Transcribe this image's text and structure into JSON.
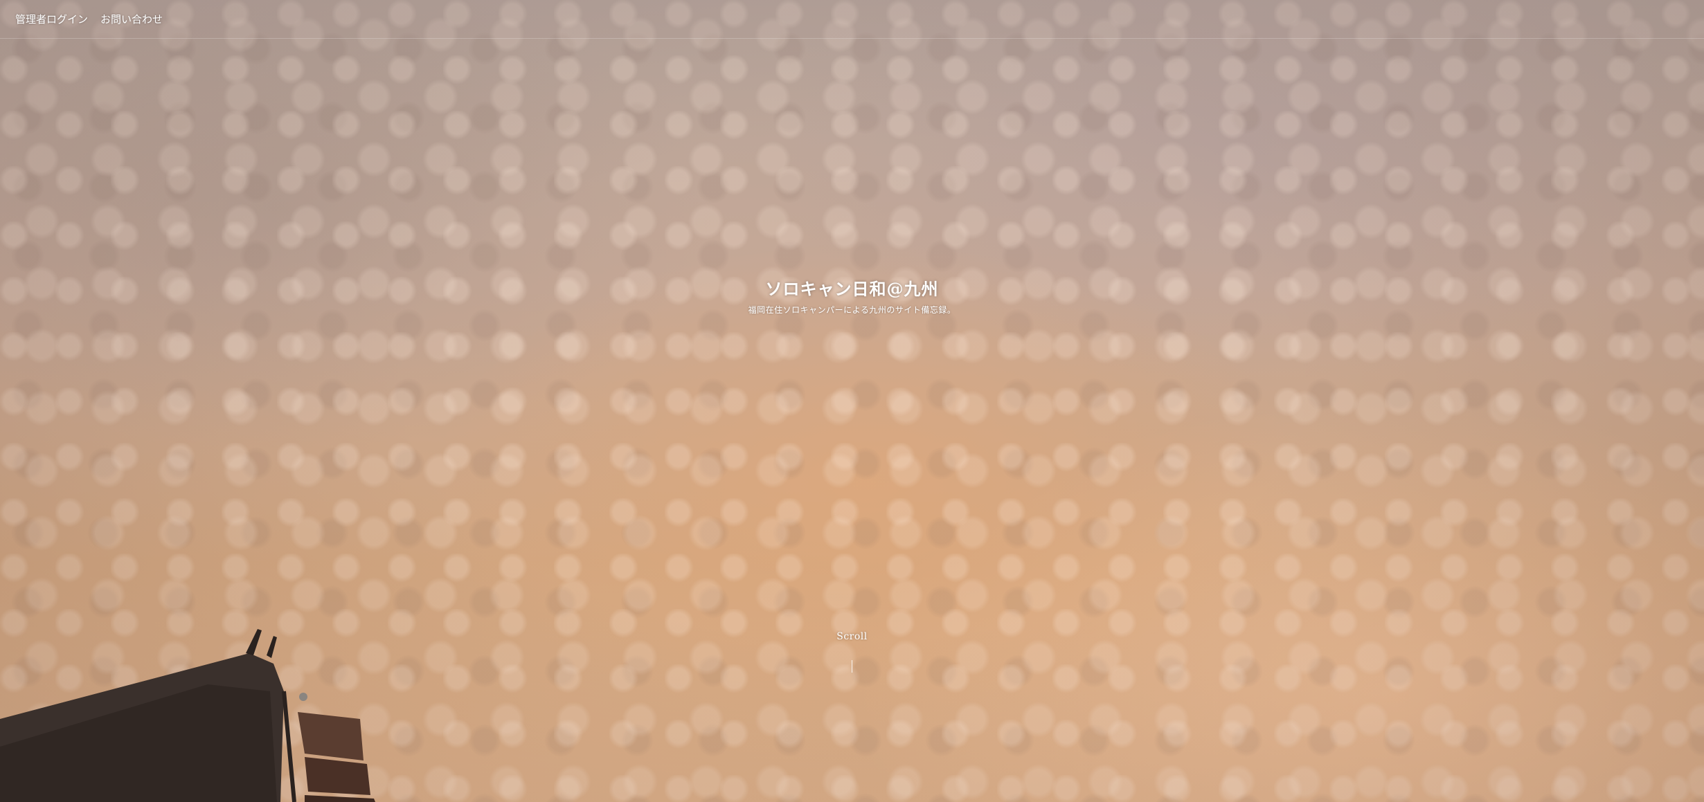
{
  "nav": {
    "items": [
      {
        "label": "管理者ログイン"
      },
      {
        "label": "お問い合わせ"
      }
    ]
  },
  "hero": {
    "title": "ソロキャン日和@九州",
    "description": "福岡在住ソロキャンパーによる九州のサイト備忘録。",
    "scroll_label": "Scroll"
  },
  "colors": {
    "sky_top": "#b6a59c",
    "sky_bottom": "#dcaf88",
    "text": "#ffffff",
    "tent": "#3a302c"
  },
  "icons": {
    "background": "cloudy-sky-photo",
    "tent": "tent-silhouette"
  }
}
